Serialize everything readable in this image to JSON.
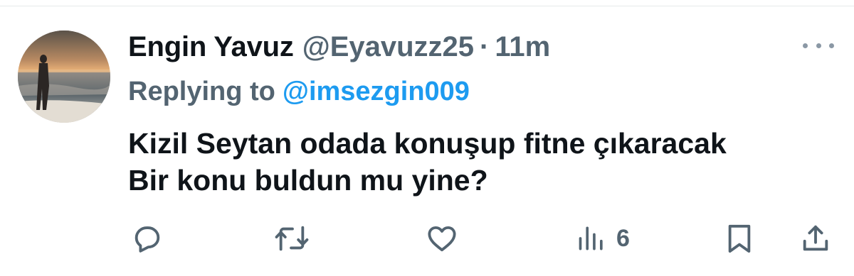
{
  "tweet": {
    "display_name": "Engin Yavuz",
    "handle": "@Eyavuzz25",
    "separator": "·",
    "time": "11m",
    "reply_prefix": "Replying to",
    "reply_handle": "@imsezgin009",
    "text_lines": [
      "Kizil Seytan odada konuşup fitne çıkaracak",
      "Bir konu buldun mu yine?"
    ]
  },
  "actions": {
    "reply_icon": "reply-icon",
    "retweet_icon": "retweet-icon",
    "like_icon": "heart-icon",
    "views_icon": "views-bar-icon",
    "views_count": "6",
    "bookmark_icon": "bookmark-icon",
    "share_icon": "share-icon"
  },
  "colors": {
    "text": "#0f1419",
    "secondary": "#536471",
    "link": "#1d9bf0"
  }
}
